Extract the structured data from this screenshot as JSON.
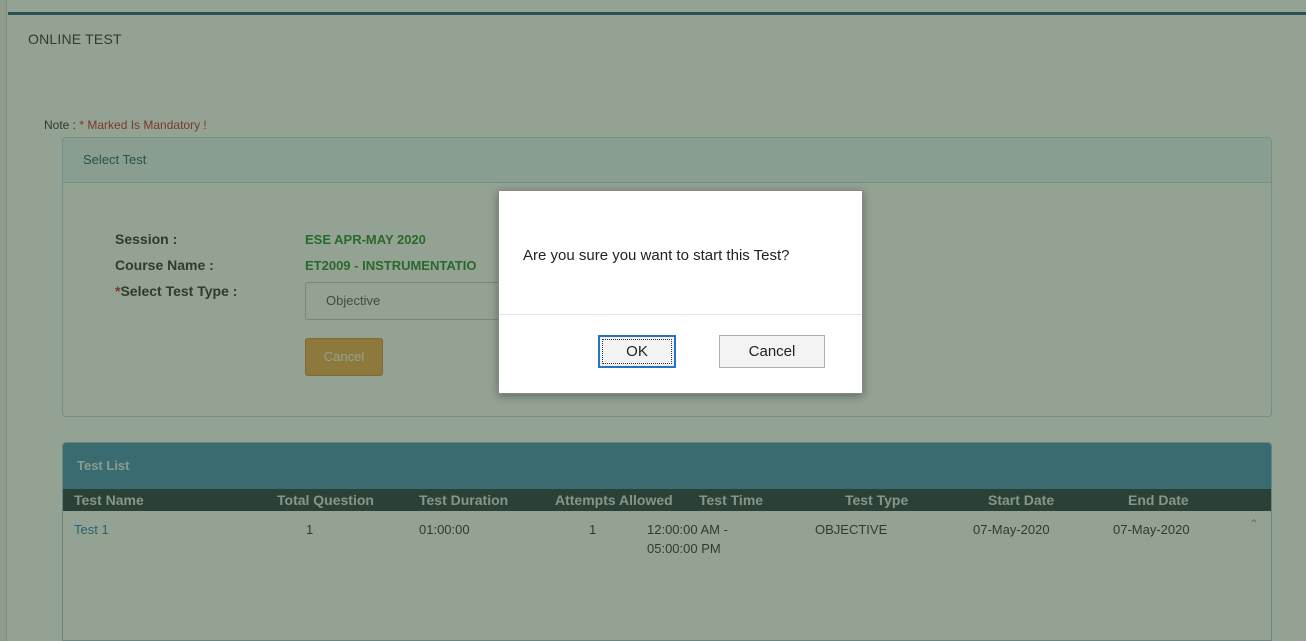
{
  "page": {
    "title": "ONLINE TEST",
    "note_label": "Note : ",
    "note_mandatory": "* Marked Is Mandatory !"
  },
  "select_panel": {
    "title": "Select Test",
    "session_label": "Session :",
    "session_value": "ESE APR-MAY 2020",
    "course_label": "Course Name :",
    "course_value": "ET2009 - INSTRUMENTATIO",
    "test_type_star": "*",
    "test_type_label": "Select Test Type :",
    "test_type_value": "Objective",
    "cancel_label": "Cancel"
  },
  "test_list": {
    "title": "Test List",
    "columns": [
      "Test Name",
      "Total Question",
      "Test Duration",
      "Attempts Allowed",
      "Test Time",
      "Test Type",
      "Start Date",
      "End Date"
    ],
    "rows": [
      {
        "test_name": "Test 1",
        "total_question": "1",
        "test_duration": "01:00:00",
        "attempts_allowed": "1",
        "test_time_line1": "12:00:00 AM -",
        "test_time_line2": "05:00:00 PM",
        "test_type": "OBJECTIVE",
        "start_date": "07-May-2020",
        "end_date": "07-May-2020"
      }
    ],
    "scroll_icon": "chevron-up-icon"
  },
  "dialog": {
    "message": "Are you sure you want to start this Test?",
    "ok_label": "OK",
    "cancel_label": "Cancel"
  },
  "colors": {
    "accent": "#2a5d7c",
    "mandatory": "#d9292b",
    "value_green": "#2e8b2e",
    "cancel_button": "#f0ad4e",
    "list_header": "#4a90b8",
    "overlay": "rgba(40,70,40,0.5)"
  }
}
